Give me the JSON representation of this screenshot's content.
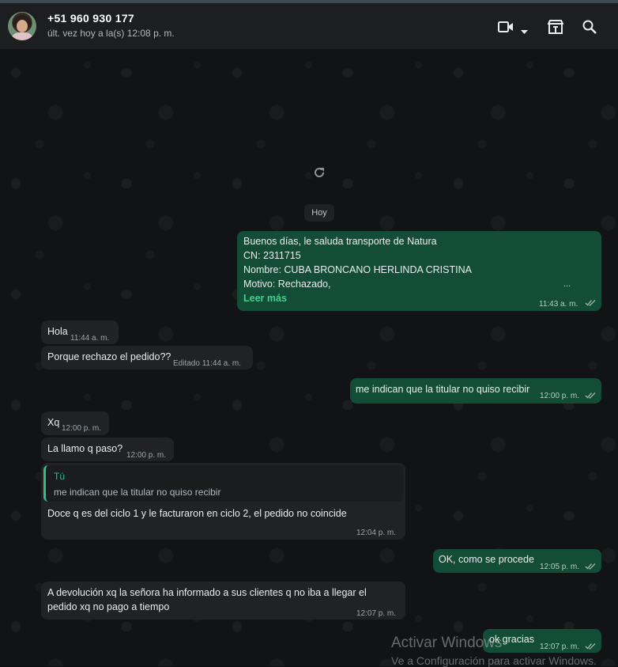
{
  "header": {
    "name": "+51 960 930 177",
    "status": "últ. vez hoy a la(s) 12:08 p. m.",
    "icons": [
      "video-camera-icon",
      "chevron-down-icon",
      "store-icon",
      "search-icon"
    ]
  },
  "chat": {
    "date_chip": "Hoy",
    "messages": [
      {
        "lines": [
          "Buenos días, le saluda transporte de Natura",
          "CN: 2311715",
          "Nombre: CUBA BRONCANO HERLINDA CRISTINA",
          "Motivo: Rechazado,"
        ],
        "ellipsis": "...",
        "read_more": "Leer más",
        "time": "11:43 a. m."
      },
      {
        "text": "Hola",
        "time": "11:44 a. m."
      },
      {
        "text": "Porque rechazo el pedido??",
        "time": "Editado 11:44 a. m."
      },
      {
        "text": "me indican que la titular no quiso recibir",
        "time": "12:00 p. m."
      },
      {
        "text": "Xq",
        "time": "12:00 p. m."
      },
      {
        "text": "La llamo q paso?",
        "time": "12:00 p. m."
      },
      {
        "quote_author": "Tú",
        "quote_text": "me indican que la titular no quiso recibir",
        "text": "Doce q es del ciclo 1 y le facturaron en ciclo 2, el pedido no coincide",
        "time": "12:04 p. m."
      },
      {
        "text": "OK, como se procede",
        "time": "12:05 p. m."
      },
      {
        "lines": [
          "A devolución xq la señora ha informado a sus clientes q no iba a llegar el",
          "pedido xq no pago a tiempo"
        ],
        "time": "12:07 p. m."
      },
      {
        "text": "ok gracias",
        "time": "12:07 p. m."
      }
    ]
  },
  "watermark": {
    "title": "Activar Windows",
    "subtitle": "Ve a Configuración para activar Windows."
  },
  "colors": {
    "outgoing_bubble": "#144d37",
    "incoming_bubble": "#202223",
    "accent": "#2fbf86"
  }
}
